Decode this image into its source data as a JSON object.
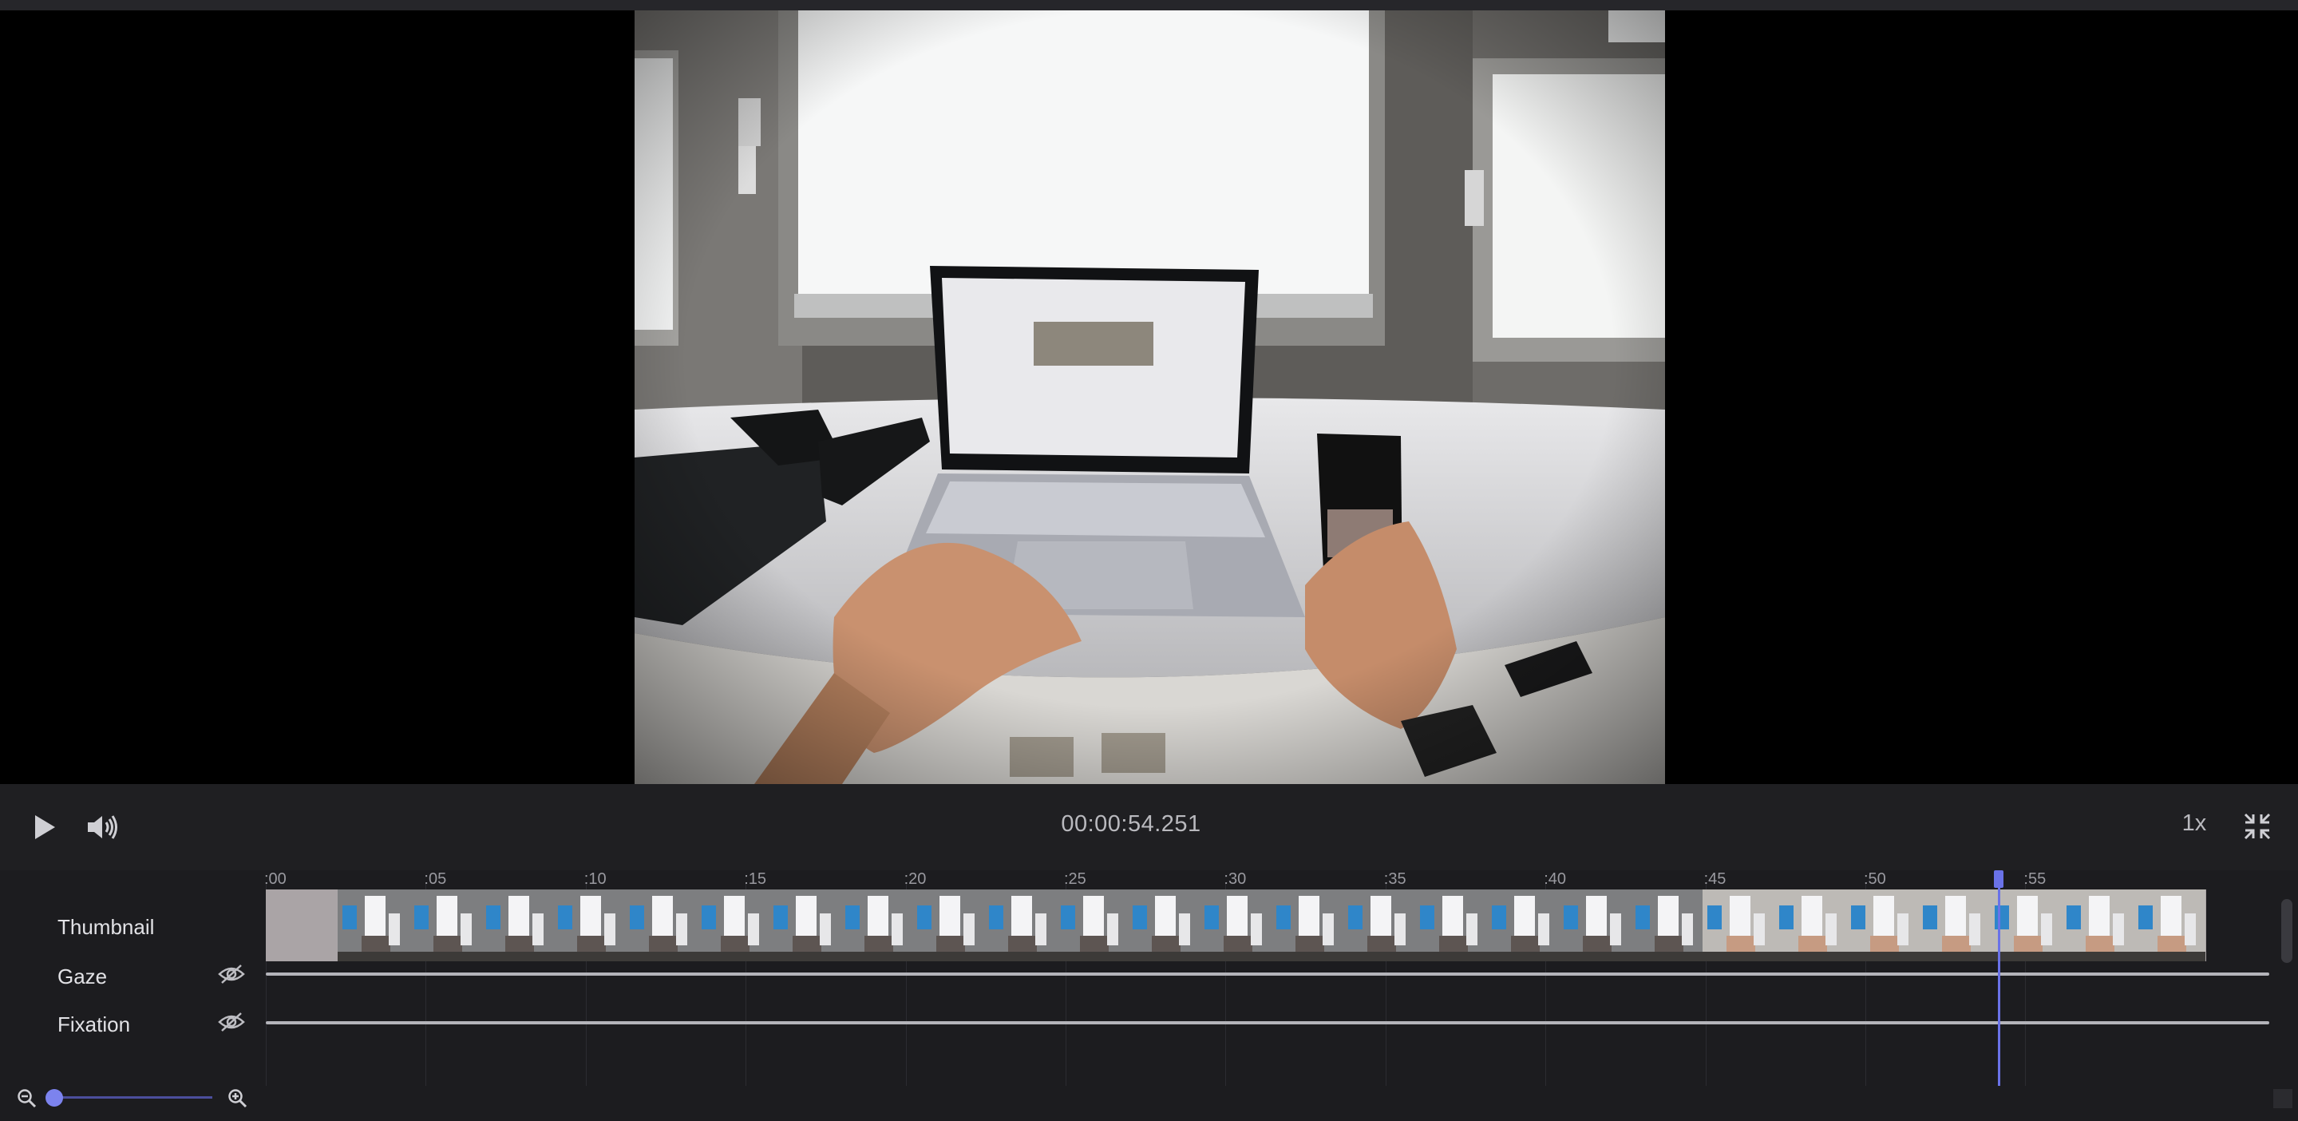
{
  "player": {
    "timecode": "00:00:54.251",
    "speed": "1x",
    "icons": {
      "play": "play-icon",
      "volume": "volume-icon",
      "fullscreen_exit": "collapse-icon"
    }
  },
  "timeline": {
    "ticks": [
      ":00",
      ":05",
      ":10",
      ":15",
      ":20",
      ":25",
      ":30",
      ":35",
      ":40",
      ":45",
      ":50",
      ":55"
    ],
    "tracks": [
      {
        "label": "Thumbnail"
      },
      {
        "label": "Gaze",
        "icon": "eye-off-icon"
      },
      {
        "label": "Fixation",
        "icon": "eye-off-icon"
      }
    ],
    "playhead_time_s": 54.251,
    "duration_s": 62.5
  },
  "zoom": {
    "level": 0.0,
    "icons": {
      "out": "zoom-out-icon",
      "in": "zoom-in-icon"
    }
  },
  "colors": {
    "accent": "#6a72e8",
    "background": "#1c1c1f",
    "track_line": "#b4b4ba"
  }
}
